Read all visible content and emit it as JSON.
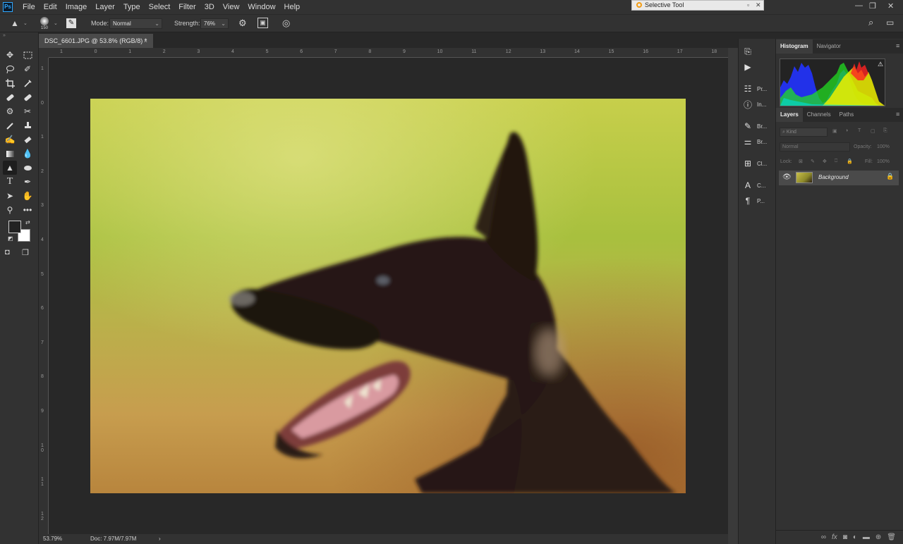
{
  "app": {
    "logo": "Ps"
  },
  "menu": [
    "File",
    "Edit",
    "Image",
    "Layer",
    "Type",
    "Select",
    "Filter",
    "3D",
    "View",
    "Window",
    "Help"
  ],
  "floating_window": {
    "title": "Selective Tool"
  },
  "options": {
    "brush_size": "150",
    "mode_label": "Mode:",
    "mode_value": "Normal",
    "strength_label": "Strength:",
    "strength_value": "76%"
  },
  "document": {
    "tab_title": "DSC_6601.JPG @ 53.8% (RGB/8) *",
    "close": "×",
    "zoom": "53.79%",
    "doc_size": "Doc: 7.97M/7.97M",
    "status_arrow": "›"
  },
  "rulers": {
    "top": [
      "1",
      "0",
      "1",
      "2",
      "3",
      "4",
      "5",
      "6",
      "7",
      "8",
      "9",
      "10",
      "11",
      "12",
      "13",
      "14",
      "15",
      "16",
      "17",
      "18"
    ],
    "left": [
      "1",
      "0",
      "1",
      "2",
      "3",
      "4",
      "5",
      "6",
      "7",
      "8",
      "9",
      "1 0",
      "1 1",
      "1 2"
    ]
  },
  "icon_strip": [
    {
      "icon": "history-icon",
      "label": ""
    },
    {
      "icon": "play-icon",
      "label": ""
    },
    {
      "icon": "properties-icon",
      "label": "Pr..."
    },
    {
      "icon": "info-icon",
      "label": "In..."
    },
    {
      "icon": "brush-icon",
      "label": "Br..."
    },
    {
      "icon": "brush-settings-icon",
      "label": "Br..."
    },
    {
      "icon": "clone-source-icon",
      "label": "Cl..."
    },
    {
      "icon": "character-icon",
      "label": "C..."
    },
    {
      "icon": "paragraph-icon",
      "label": "P..."
    }
  ],
  "panels": {
    "top_tabs": [
      "Histogram",
      "Navigator"
    ],
    "layer_tabs": [
      "Layers",
      "Channels",
      "Paths"
    ],
    "kind_label": "Kind",
    "blend_mode": "Normal",
    "opacity_label": "Opacity:",
    "opacity_value": "100%",
    "lock_label": "Lock:",
    "fill_label": "Fill:",
    "fill_value": "100%",
    "layer_name": "Background"
  },
  "colors": {
    "accent": "#31a8ff",
    "panel": "#323232",
    "canvas_bg": "#282828"
  }
}
